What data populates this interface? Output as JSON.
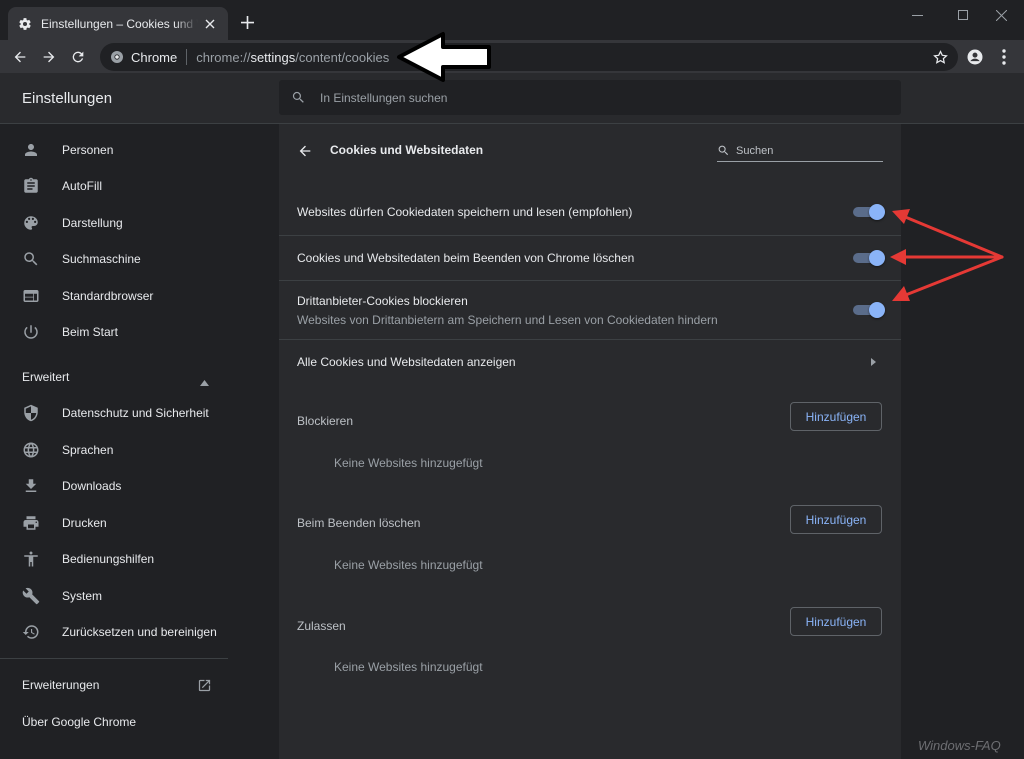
{
  "browser": {
    "tab_title": "Einstellungen – Cookies und Websitedaten",
    "omnibox_chip": "Chrome",
    "url_prefix": "chrome://",
    "url_host": "settings",
    "url_path": "/content/cookies"
  },
  "settings": {
    "title": "Einstellungen",
    "search_placeholder": "In Einstellungen suchen"
  },
  "sidebar": {
    "items": [
      {
        "label": "Personen",
        "icon": "person-icon"
      },
      {
        "label": "AutoFill",
        "icon": "clipboard-icon"
      },
      {
        "label": "Darstellung",
        "icon": "palette-icon"
      },
      {
        "label": "Suchmaschine",
        "icon": "search-icon"
      },
      {
        "label": "Standardbrowser",
        "icon": "browser-icon"
      },
      {
        "label": "Beim Start",
        "icon": "power-icon"
      }
    ],
    "advanced_label": "Erweitert",
    "advanced_items": [
      {
        "label": "Datenschutz und Sicherheit",
        "icon": "shield-icon"
      },
      {
        "label": "Sprachen",
        "icon": "globe-icon"
      },
      {
        "label": "Downloads",
        "icon": "download-icon"
      },
      {
        "label": "Drucken",
        "icon": "printer-icon"
      },
      {
        "label": "Bedienungshilfen",
        "icon": "accessibility-icon"
      },
      {
        "label": "System",
        "icon": "wrench-icon"
      },
      {
        "label": "Zurücksetzen und bereinigen",
        "icon": "reset-icon"
      }
    ],
    "extensions_label": "Erweiterungen",
    "about_label": "Über Google Chrome"
  },
  "page": {
    "title": "Cookies und Websitedaten",
    "search_placeholder": "Suchen",
    "toggles": [
      {
        "label": "Websites dürfen Cookiedaten speichern und lesen (empfohlen)",
        "sublabel": "",
        "on": true
      },
      {
        "label": "Cookies und Websitedaten beim Beenden von Chrome löschen",
        "sublabel": "",
        "on": true
      },
      {
        "label": "Drittanbieter-Cookies blockieren",
        "sublabel": "Websites von Drittanbietern am Speichern und Lesen von Cookiedaten hindern",
        "on": true
      }
    ],
    "all_cookies_label": "Alle Cookies und Websitedaten anzeigen",
    "sections": [
      {
        "label": "Blockieren",
        "button": "Hinzufügen",
        "empty": "Keine Websites hinzugefügt"
      },
      {
        "label": "Beim Beenden löschen",
        "button": "Hinzufügen",
        "empty": "Keine Websites hinzugefügt"
      },
      {
        "label": "Zulassen",
        "button": "Hinzufügen",
        "empty": "Keine Websites hinzugefügt"
      }
    ]
  },
  "watermark": "Windows-FAQ",
  "colors": {
    "accent": "#8ab4f8",
    "annotation_red": "#e53935",
    "background": "#202124",
    "card": "#292a2d"
  }
}
